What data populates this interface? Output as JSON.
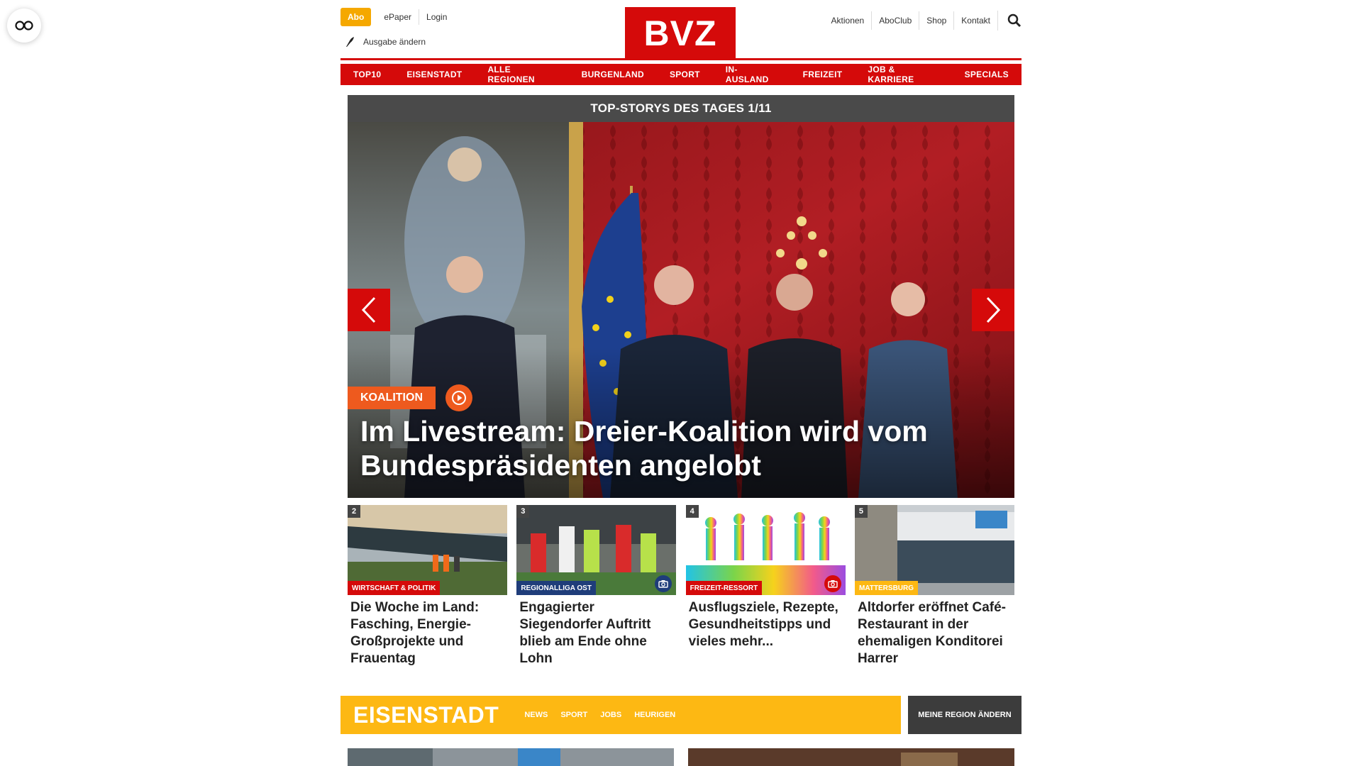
{
  "accessibility": {
    "icon": "accessibility-glasses-icon"
  },
  "header": {
    "abo": "Abo",
    "left_links": [
      "ePaper",
      "Login"
    ],
    "ausgabe": "Ausgabe ändern",
    "logo": "BVZ",
    "right_links": [
      "Aktionen",
      "AboClub",
      "Shop",
      "Kontakt"
    ],
    "search_icon": "search-icon"
  },
  "nav": [
    "TOP10",
    "EISENSTADT",
    "ALLE REGIONEN",
    "BURGENLAND",
    "SPORT",
    "IN-AUSLAND",
    "FREIZEIT",
    "JOB & KARRIERE",
    "SPECIALS"
  ],
  "top_stories": {
    "heading": "TOP-STORYS DES TAGES 1/11",
    "hero": {
      "tag": "KOALITION",
      "title": "Im Livestream: Dreier-Koalition wird vom Bundespräsidenten angelobt"
    },
    "cards": [
      {
        "num": "2",
        "category": "WIRTSCHAFT & POLITIK",
        "cat_color": "#d50a0a",
        "title": "Die Woche im Land: Fasching, Energie-Großprojekte und Frauentag"
      },
      {
        "num": "3",
        "category": "REGIONALLIGA OST",
        "cat_color": "#1f3d7a",
        "title": "Engagierter Siegendorfer Auftritt blieb am Ende ohne Lohn"
      },
      {
        "num": "4",
        "category": "FREIZEIT-RESSORT",
        "cat_color": "#d50a0a",
        "title": "Ausflugsziele, Rezepte, Gesundheitstipps und vieles mehr..."
      },
      {
        "num": "5",
        "category": "MATTERSBURG",
        "cat_color": "#fdb813",
        "title": "Altdorfer eröffnet Café-Restaurant in der ehemaligen Konditorei Harrer"
      }
    ]
  },
  "region": {
    "name": "EISENSTADT",
    "links": [
      "NEWS",
      "SPORT",
      "JOBS",
      "HEURIGEN"
    ],
    "change_button": "MEINE REGION ÄNDERN"
  }
}
